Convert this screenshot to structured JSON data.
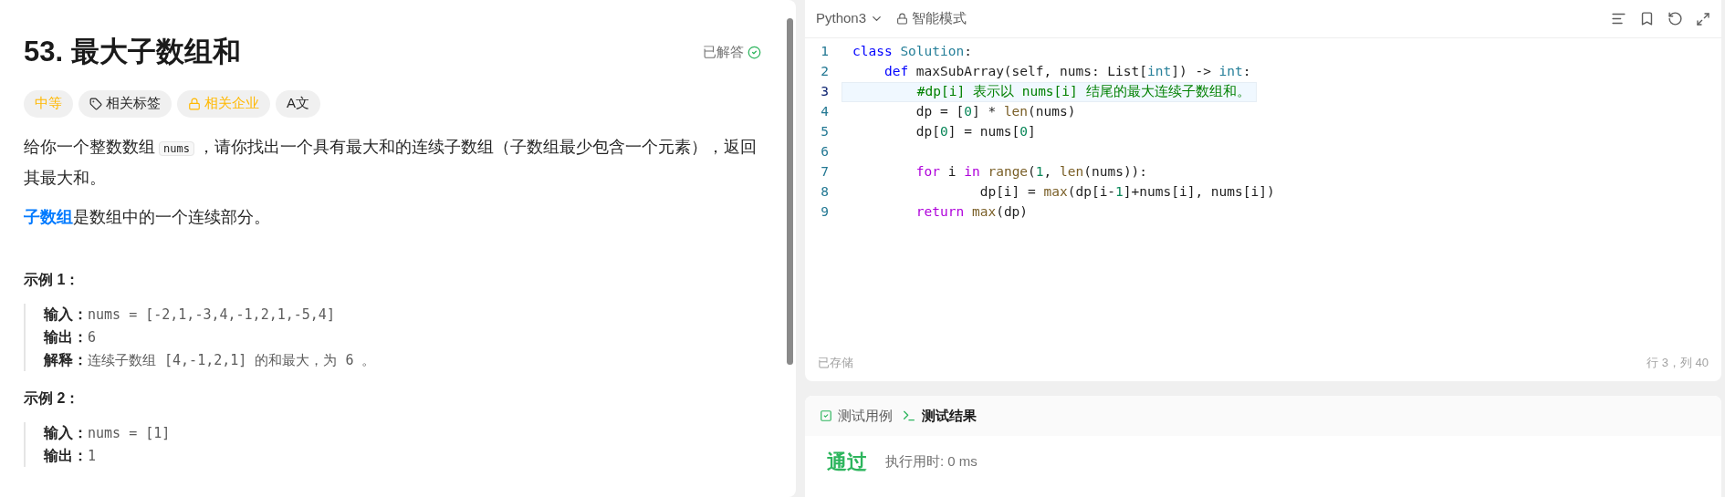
{
  "problem": {
    "title": "53. 最大子数组和",
    "status": "已解答",
    "tags": [
      {
        "kind": "difficulty",
        "label": "中等"
      },
      {
        "kind": "tag",
        "label": "相关标签"
      },
      {
        "kind": "locked",
        "label": "相关企业"
      },
      {
        "kind": "translate",
        "label": "A文"
      }
    ],
    "description": {
      "before": "给你一个整数数组",
      "code": "nums",
      "after": "，请你找出一个具有最大和的连续子数组（子数组最少包含一个元素），返回其最大和。"
    },
    "definition": {
      "link": "子数组",
      "text": "是数组中的一个连续部分。"
    },
    "examples": [
      {
        "title": "示例 1：",
        "lines": [
          {
            "label": "输入：",
            "value": "nums = [-2,1,-3,4,-1,2,1,-5,4]"
          },
          {
            "label": "输出：",
            "value": "6"
          },
          {
            "label": "解释：",
            "value": "连续子数组 [4,-1,2,1] 的和最大，为 6 。"
          }
        ]
      },
      {
        "title": "示例 2：",
        "lines": [
          {
            "label": "输入：",
            "value": "nums = [1]"
          },
          {
            "label": "输出：",
            "value": "1"
          }
        ]
      }
    ]
  },
  "editor": {
    "language": "Python3",
    "mode": "智能模式",
    "lines": [
      {
        "number": "1",
        "selected": false,
        "tokens": [
          {
            "kind": "keyword",
            "text": "class "
          },
          {
            "kind": "type",
            "text": "Solution"
          },
          {
            "kind": "plain",
            "text": ":"
          }
        ]
      },
      {
        "number": "2",
        "selected": false,
        "tokens": [
          {
            "kind": "keyword",
            "text": "    def "
          },
          {
            "kind": "plain",
            "text": "maxSubArray(self, nums: List["
          },
          {
            "kind": "type",
            "text": "int"
          },
          {
            "kind": "plain",
            "text": "]) -> "
          },
          {
            "kind": "type",
            "text": "int"
          },
          {
            "kind": "plain",
            "text": ":"
          }
        ]
      },
      {
        "number": "3",
        "selected": true,
        "tokens": [
          {
            "kind": "comment",
            "text": "        #dp[i] 表示以 nums[i] 结尾的最大连续子数组和。"
          }
        ]
      },
      {
        "number": "4",
        "selected": false,
        "tokens": [
          {
            "kind": "plain",
            "text": "        dp = ["
          },
          {
            "kind": "number",
            "text": "0"
          },
          {
            "kind": "plain",
            "text": "] * "
          },
          {
            "kind": "builtin",
            "text": "len"
          },
          {
            "kind": "plain",
            "text": "(nums)"
          }
        ]
      },
      {
        "number": "5",
        "selected": false,
        "tokens": [
          {
            "kind": "plain",
            "text": "        dp["
          },
          {
            "kind": "number",
            "text": "0"
          },
          {
            "kind": "plain",
            "text": "] = nums["
          },
          {
            "kind": "number",
            "text": "0"
          },
          {
            "kind": "plain",
            "text": "]"
          }
        ]
      },
      {
        "number": "6",
        "selected": false
      },
      {
        "number": "7",
        "selected": false,
        "tokens": [
          {
            "kind": "control",
            "text": "        for "
          },
          {
            "kind": "plain",
            "text": "i "
          },
          {
            "kind": "control",
            "text": "in "
          },
          {
            "kind": "builtin",
            "text": "range"
          },
          {
            "kind": "plain",
            "text": "("
          },
          {
            "kind": "number",
            "text": "1"
          },
          {
            "kind": "plain",
            "text": ", "
          },
          {
            "kind": "builtin",
            "text": "len"
          },
          {
            "kind": "plain",
            "text": "(nums)):"
          }
        ]
      },
      {
        "number": "8",
        "selected": false,
        "tokens": [
          {
            "kind": "plain",
            "text": "                dp[i] = "
          },
          {
            "kind": "builtin",
            "text": "max"
          },
          {
            "kind": "plain",
            "text": "(dp[i-"
          },
          {
            "kind": "number",
            "text": "1"
          },
          {
            "kind": "plain",
            "text": "]+nums[i], nums[i])"
          }
        ]
      },
      {
        "number": "9",
        "selected": false,
        "tokens": [
          {
            "kind": "control",
            "text": "        return "
          },
          {
            "kind": "builtin",
            "text": "max"
          },
          {
            "kind": "plain",
            "text": "(dp)"
          }
        ]
      }
    ],
    "saved": "已存储",
    "cursor": "行 3，列 40"
  },
  "results": {
    "tabs": [
      {
        "kind": "cases",
        "label": "测试用例",
        "selected": false
      },
      {
        "kind": "result",
        "label": "测试结果",
        "selected": true
      }
    ],
    "verdict": "通过",
    "runtime": "执行用时: 0 ms"
  }
}
